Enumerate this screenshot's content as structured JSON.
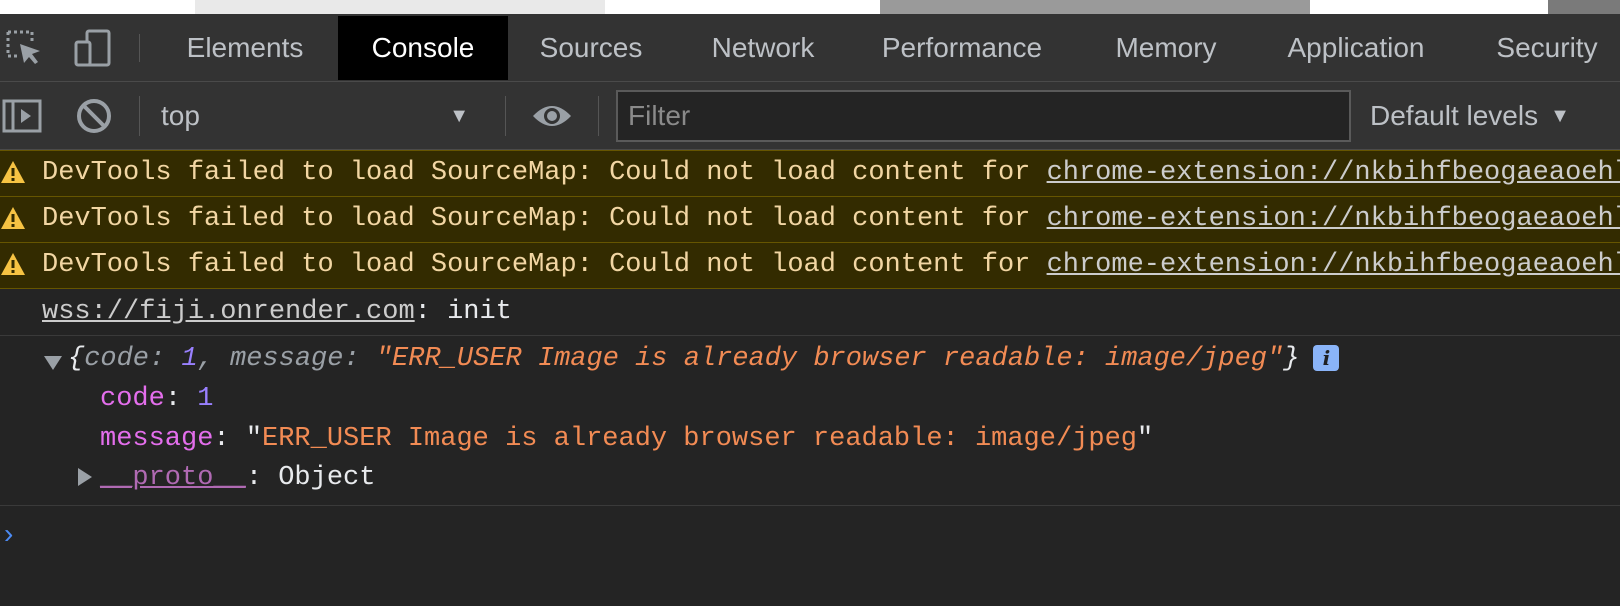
{
  "tabs": [
    {
      "label": "Elements",
      "active": false
    },
    {
      "label": "Console",
      "active": true
    },
    {
      "label": "Sources",
      "active": false
    },
    {
      "label": "Network",
      "active": false
    },
    {
      "label": "Performance",
      "active": false
    },
    {
      "label": "Memory",
      "active": false
    },
    {
      "label": "Application",
      "active": false
    },
    {
      "label": "Security",
      "active": false
    }
  ],
  "toolbar": {
    "context": "top",
    "filter_placeholder": "Filter",
    "levels_label": "Default levels"
  },
  "console": {
    "warnings": [
      {
        "text": "DevTools failed to load SourceMap: Could not load content for ",
        "link": "chrome-extension://nkbihfbeogaeaoehlefnkodbefgpgknn/sourcemaps/contentscript.js.map"
      },
      {
        "text": "DevTools failed to load SourceMap: Could not load content for ",
        "link": "chrome-extension://nkbihfbeogaeaoehlefnkodbefgpgknn/sourcemaps/inpage.js.map"
      },
      {
        "text": "DevTools failed to load SourceMap: Could not load content for ",
        "link": "chrome-extension://nkbihfbeogaeaoehlefnkodbefgpgknn/sourcemaps/background.js.map"
      }
    ],
    "log": {
      "link": "wss://fiji.onrender.com",
      "text": ": init"
    },
    "object": {
      "preview_code_key": "code",
      "preview_code_value": "1",
      "preview_message_key": "message",
      "preview_message_value": "\"ERR_USER Image is already browser readable: image/jpeg\"",
      "info_badge": "i",
      "code_key": "code",
      "code_value": "1",
      "message_key": "message",
      "message_value": "ERR_USER Image is already browser readable: image/jpeg",
      "proto_key": "__proto__",
      "proto_value": "Object"
    },
    "prompt": "›"
  },
  "colors": {
    "warning_bg": "#332b00",
    "warning_text": "#f2d6a3",
    "string": "#f28b54",
    "number": "#9980ff",
    "property": "#e36eec",
    "prompt": "#4c8bf5"
  }
}
